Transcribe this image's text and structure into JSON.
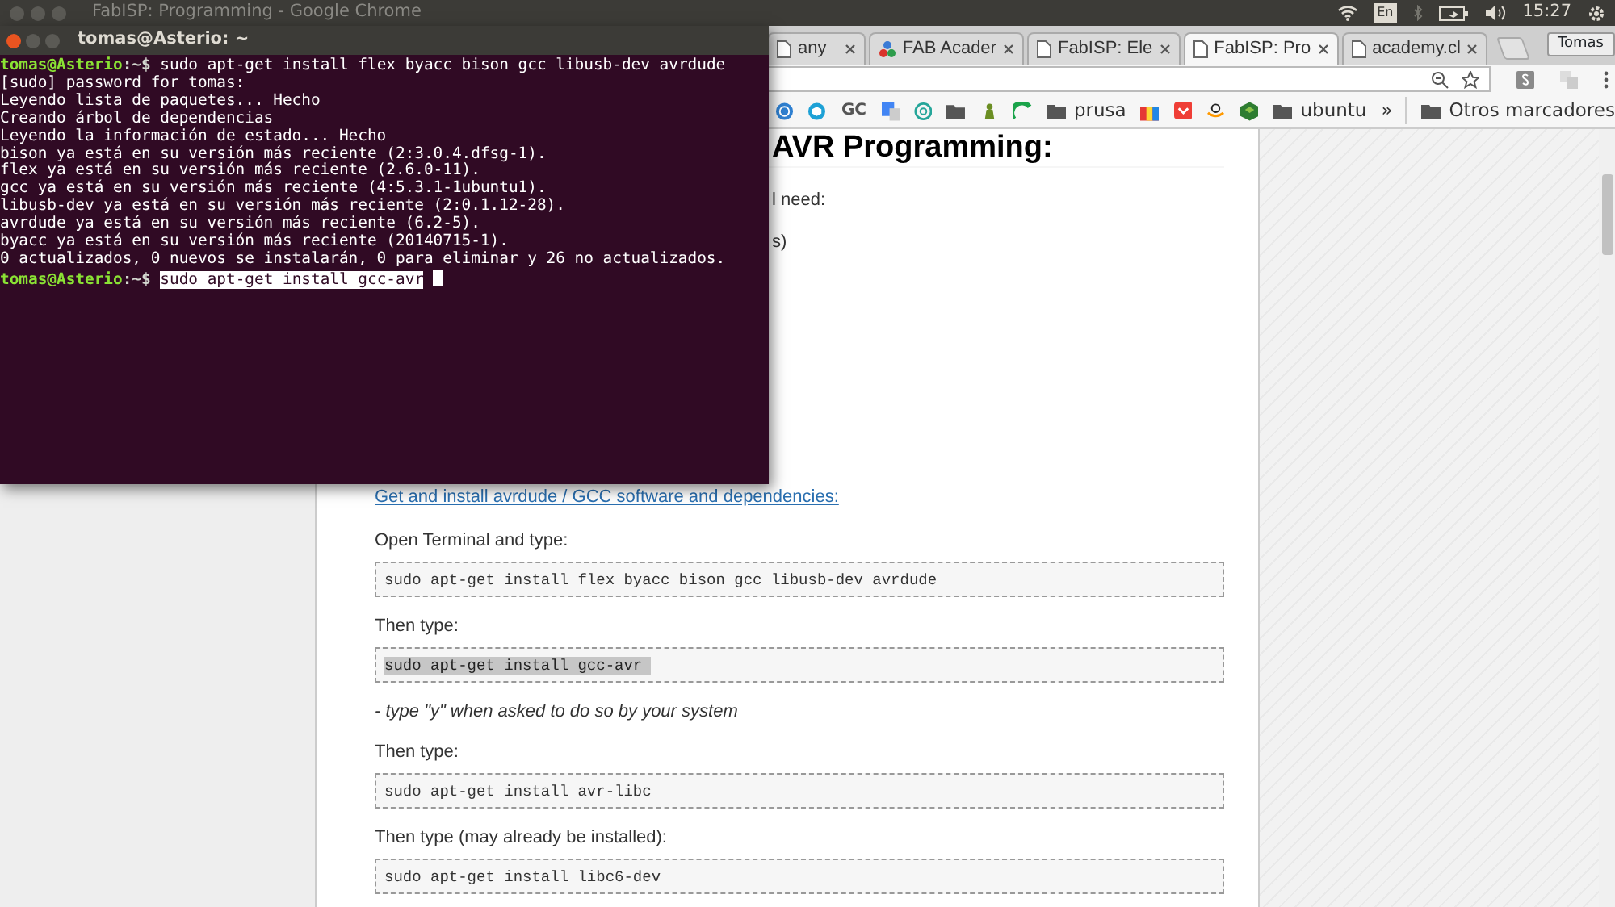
{
  "top_panel": {
    "window_title": "FabISP: Programming - Google Chrome",
    "keyboard_layout": "En",
    "clock": "15:27"
  },
  "browser": {
    "tabs": [
      {
        "title": "any",
        "selected": false,
        "kind": "page"
      },
      {
        "title": "FAB Acader",
        "selected": false,
        "kind": "site"
      },
      {
        "title": "FabISP: Ele",
        "selected": false,
        "kind": "page"
      },
      {
        "title": "FabISP: Pro",
        "selected": true,
        "kind": "page"
      },
      {
        "title": "academy.cl",
        "selected": false,
        "kind": "page"
      }
    ],
    "profile": "Tomas",
    "bookmarks": [
      {
        "kind": "favicon"
      },
      {
        "kind": "favicon"
      },
      {
        "kind": "text",
        "label": "GC"
      },
      {
        "kind": "favicon"
      },
      {
        "kind": "favicon"
      },
      {
        "kind": "favicon"
      },
      {
        "kind": "favicon"
      },
      {
        "kind": "favicon"
      },
      {
        "kind": "folder",
        "label": "prusa"
      },
      {
        "kind": "favicon"
      },
      {
        "kind": "favicon"
      },
      {
        "kind": "favicon"
      },
      {
        "kind": "favicon"
      },
      {
        "kind": "folder",
        "label": "ubuntu"
      },
      {
        "kind": "more",
        "label": "»"
      },
      {
        "kind": "folder",
        "label": "Otros marcadores"
      }
    ]
  },
  "terminal": {
    "title": "tomas@Asterio: ~",
    "lines": [
      {
        "kind": "prompt",
        "user": "tomas@Asterio",
        "path": ":~$",
        "command": "sudo apt-get install flex byacc bison gcc libusb-dev avrdude",
        "selected": false
      },
      {
        "kind": "output",
        "text": "[sudo] password for tomas:"
      },
      {
        "kind": "output",
        "text": "Leyendo lista de paquetes... Hecho"
      },
      {
        "kind": "output",
        "text": "Creando árbol de dependencias"
      },
      {
        "kind": "output",
        "text": "Leyendo la información de estado... Hecho"
      },
      {
        "kind": "output",
        "text": "bison ya está en su versión más reciente (2:3.0.4.dfsg-1)."
      },
      {
        "kind": "output",
        "text": "flex ya está en su versión más reciente (2.6.0-11)."
      },
      {
        "kind": "output",
        "text": "gcc ya está en su versión más reciente (4:5.3.1-1ubuntu1)."
      },
      {
        "kind": "output",
        "text": "libusb-dev ya está en su versión más reciente (2:0.1.12-28)."
      },
      {
        "kind": "output",
        "text": "avrdude ya está en su versión más reciente (6.2-5)."
      },
      {
        "kind": "output",
        "text": "byacc ya está en su versión más reciente (20140715-1)."
      },
      {
        "kind": "output",
        "text": "0 actualizados, 0 nuevos se instalarán, 0 para eliminar y 26 no actualizados."
      },
      {
        "kind": "prompt",
        "user": "tomas@Asterio",
        "path": ":~$",
        "command": "sudo apt-get install gcc-avr",
        "selected": true,
        "cursor": true
      }
    ]
  },
  "page": {
    "heading": "AVR Programming:",
    "fragments": [
      "l need:",
      "s)"
    ],
    "link": "Get and install avrdude / GCC software and dependencies:",
    "blocks": [
      {
        "kind": "text",
        "text": "Open Terminal and type:"
      },
      {
        "kind": "code",
        "text": "sudo apt-get install flex byacc bison gcc libusb-dev avrdude",
        "selected": false
      },
      {
        "kind": "text",
        "text": "Then type:"
      },
      {
        "kind": "code",
        "text": "sudo apt-get install gcc-avr ",
        "selected": true
      },
      {
        "kind": "note",
        "text": "- type \"y\" when asked to do so by your system"
      },
      {
        "kind": "text",
        "text": "Then type:"
      },
      {
        "kind": "code",
        "text": "sudo apt-get install avr-libc",
        "selected": false
      },
      {
        "kind": "text",
        "text": "Then type (may already be installed):"
      },
      {
        "kind": "code",
        "text": "sudo apt-get install libc6-dev",
        "selected": false
      }
    ]
  }
}
